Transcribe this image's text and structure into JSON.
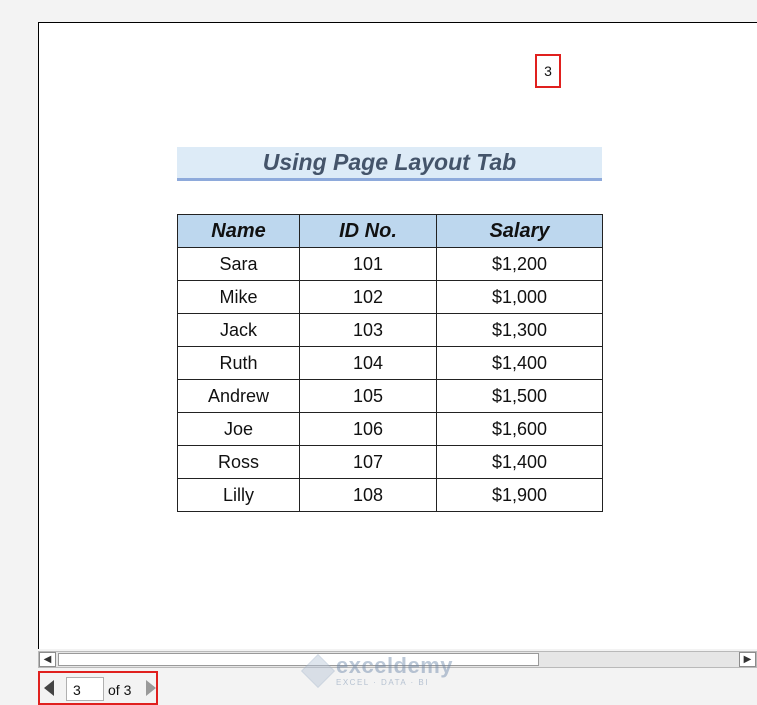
{
  "page_number": "3",
  "title": "Using Page Layout Tab",
  "table": {
    "headers": [
      "Name",
      "ID No.",
      "Salary"
    ],
    "rows": [
      [
        "Sara",
        "101",
        "$1,200"
      ],
      [
        "Mike",
        "102",
        "$1,000"
      ],
      [
        "Jack",
        "103",
        "$1,300"
      ],
      [
        "Ruth",
        "104",
        "$1,400"
      ],
      [
        "Andrew",
        "105",
        "$1,500"
      ],
      [
        "Joe",
        "106",
        "$1,600"
      ],
      [
        "Ross",
        "107",
        "$1,400"
      ],
      [
        "Lilly",
        "108",
        "$1,900"
      ]
    ]
  },
  "navigation": {
    "current_page": "3",
    "total_label": "of 3"
  },
  "watermark": {
    "brand": "exceldemy",
    "tagline": "EXCEL · DATA · BI"
  },
  "icons": {
    "prev": "triangle-left-icon",
    "next": "triangle-right-icon",
    "scroll_left": "scroll-left-arrow-icon",
    "scroll_right": "scroll-right-arrow-icon"
  },
  "colors": {
    "highlight_border": "#e0201e",
    "title_bg": "#ddebf7",
    "header_bg": "#bdd7ee",
    "title_text": "#44546a"
  }
}
